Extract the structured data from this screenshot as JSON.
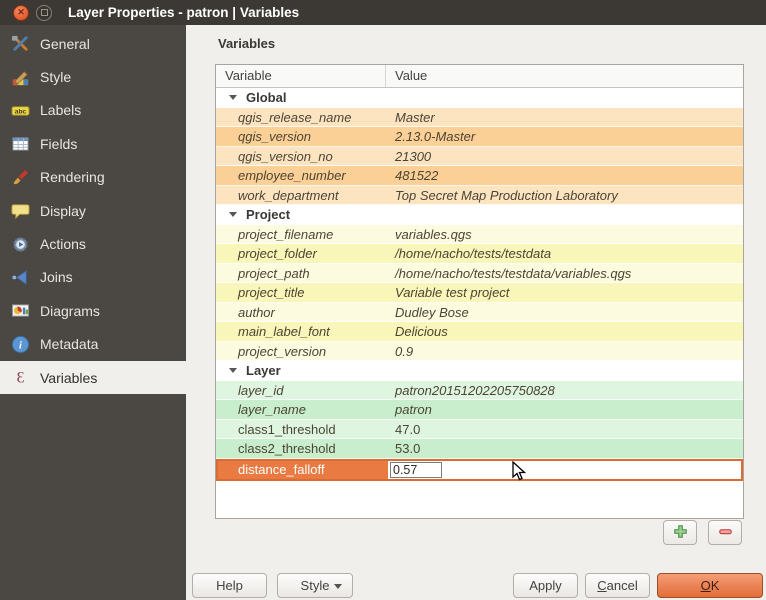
{
  "window": {
    "title": "Layer Properties - patron | Variables"
  },
  "titlebar": {
    "buttons": [
      "close-icon",
      "maximize-icon"
    ]
  },
  "sidebar": {
    "selected": "Variables",
    "items": [
      {
        "label": "General",
        "icon": "general-icon"
      },
      {
        "label": "Style",
        "icon": "style-icon"
      },
      {
        "label": "Labels",
        "icon": "labels-icon"
      },
      {
        "label": "Fields",
        "icon": "fields-icon"
      },
      {
        "label": "Rendering",
        "icon": "rendering-icon"
      },
      {
        "label": "Display",
        "icon": "display-icon"
      },
      {
        "label": "Actions",
        "icon": "actions-icon"
      },
      {
        "label": "Joins",
        "icon": "joins-icon"
      },
      {
        "label": "Diagrams",
        "icon": "diagrams-icon"
      },
      {
        "label": "Metadata",
        "icon": "metadata-icon"
      },
      {
        "label": "Variables",
        "icon": "variables-icon"
      }
    ]
  },
  "main": {
    "heading": "Variables",
    "table": {
      "columns": [
        "Variable",
        "Value"
      ],
      "groups": [
        {
          "name": "Global",
          "row_colors": [
            "#fce4c1",
            "#fbd096"
          ],
          "rows": [
            {
              "variable": "qgis_release_name",
              "value": "Master",
              "italic": true
            },
            {
              "variable": "qgis_version",
              "value": "2.13.0-Master",
              "italic": true
            },
            {
              "variable": "qgis_version_no",
              "value": "21300",
              "italic": true
            },
            {
              "variable": "employee_number",
              "value": "481522",
              "italic": true
            },
            {
              "variable": "work_department",
              "value": "Top Secret Map Production Laboratory",
              "italic": true
            }
          ]
        },
        {
          "name": "Project",
          "row_colors": [
            "#fcfbdf",
            "#f8f6b8"
          ],
          "rows": [
            {
              "variable": "project_filename",
              "value": "variables.qgs",
              "italic": true
            },
            {
              "variable": "project_folder",
              "value": "/home/nacho/tests/testdata",
              "italic": true
            },
            {
              "variable": "project_path",
              "value": "/home/nacho/tests/testdata/variables.qgs",
              "italic": true
            },
            {
              "variable": "project_title",
              "value": "Variable test project",
              "italic": true
            },
            {
              "variable": "author",
              "value": "Dudley Bose",
              "italic": true
            },
            {
              "variable": "main_label_font",
              "value": "Delicious",
              "italic": true
            },
            {
              "variable": "project_version",
              "value": "0.9",
              "italic": true
            }
          ]
        },
        {
          "name": "Layer",
          "row_colors": [
            "#def5e0",
            "#c8eecd"
          ],
          "rows": [
            {
              "variable": "layer_id",
              "value": "patron20151202205750828",
              "italic": true
            },
            {
              "variable": "layer_name",
              "value": "patron",
              "italic": true
            },
            {
              "variable": "class1_threshold",
              "value": "47.0",
              "italic": false
            },
            {
              "variable": "class2_threshold",
              "value": "53.0",
              "italic": false
            },
            {
              "variable": "distance_falloff",
              "value": "0.57",
              "italic": false,
              "editing": true
            }
          ]
        }
      ]
    },
    "buttons": {
      "add_icon": "plus-icon",
      "remove_icon": "minus-icon"
    }
  },
  "footer": {
    "help": "Help",
    "style": "Style",
    "apply": "Apply",
    "cancel": "Cancel",
    "ok": "OK"
  },
  "colors": {
    "titlebar_bg": "#3c3833",
    "sidebar_bg": "#4b4742",
    "editing_row": "#e87a42",
    "editing_border": "#dc6a33",
    "ok_button": "#e5713c"
  }
}
